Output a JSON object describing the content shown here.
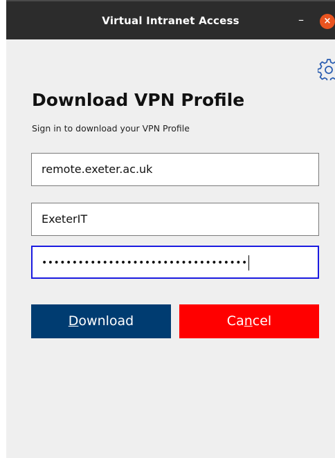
{
  "window": {
    "title": "Virtual Intranet Access",
    "minimize_symbol": "–",
    "close_symbol": "×",
    "close_color": "#e95420"
  },
  "settings": {
    "icon": "gear-icon"
  },
  "form": {
    "heading": "Download VPN Profile",
    "subtitle": "Sign in to download your VPN Profile",
    "server_value": "remote.exeter.ac.uk",
    "username_value": "ExeterIT",
    "password_masked": "••••••••••••••••••••••••••••••••••"
  },
  "buttons": {
    "download": {
      "mnemonic": "D",
      "rest": "ownload",
      "color": "#003c71"
    },
    "cancel": {
      "before": "Ca",
      "mnemonic": "n",
      "after": "cel",
      "color": "#ff0000"
    }
  }
}
